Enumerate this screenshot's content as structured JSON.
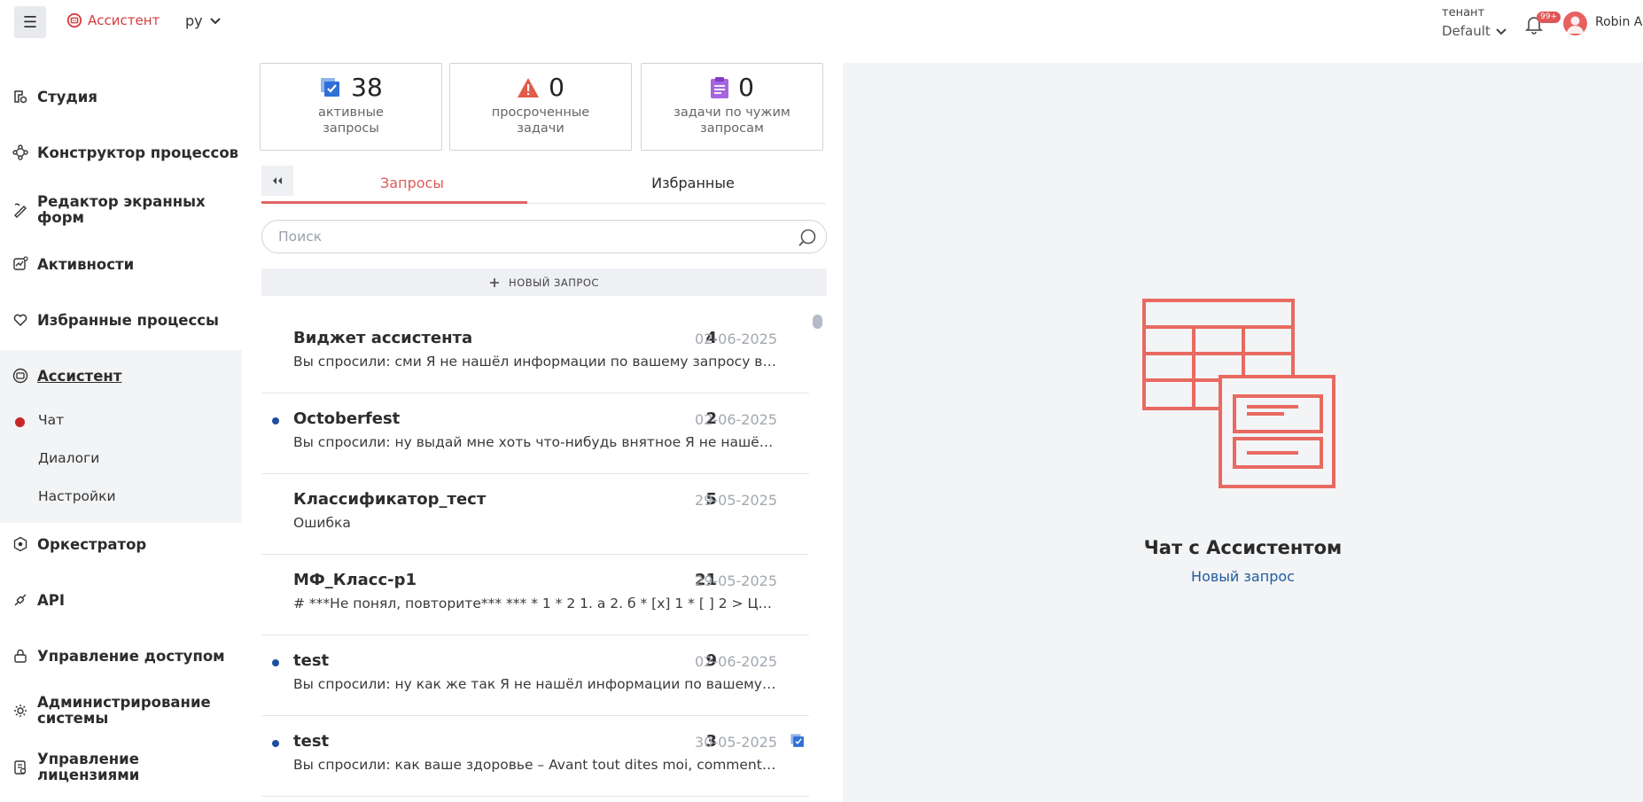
{
  "header": {
    "brand": "Ассистент",
    "language": "ру",
    "tenant_label": "тенант",
    "tenant_value": "Default",
    "notifications_badge": "99+",
    "user_name": "Robin A."
  },
  "sidebar": {
    "items": [
      {
        "label": "Студия",
        "icon": "studio-icon"
      },
      {
        "label": "Конструктор процессов",
        "icon": "process-icon"
      },
      {
        "label": "Редактор экранных форм",
        "icon": "form-editor-icon"
      },
      {
        "label": "Активности",
        "icon": "activities-icon"
      },
      {
        "label": "Избранные процессы",
        "icon": "heart-icon"
      },
      {
        "label": "Ассистент",
        "icon": "assistant-icon"
      },
      {
        "label": "Оркестратор",
        "icon": "orchestrator-icon"
      },
      {
        "label": "API",
        "icon": "api-icon"
      },
      {
        "label": "Управление доступом",
        "icon": "lock-icon"
      },
      {
        "label": "Администрирование системы",
        "icon": "admin-icon"
      },
      {
        "label": "Управление лицензиями",
        "icon": "license-icon"
      }
    ],
    "sub_items": [
      "Чат",
      "Диалоги",
      "Настройки"
    ]
  },
  "stats": [
    {
      "value": "38",
      "label": "активные запросы"
    },
    {
      "value": "0",
      "label": "просроченные задачи"
    },
    {
      "value": "0",
      "label": "задачи по чужим запросам"
    }
  ],
  "tabs": [
    "Запросы",
    "Избранные"
  ],
  "search": {
    "placeholder": "Поиск"
  },
  "new_request_label": "НОВЫЙ ЗАПРОС",
  "requests": [
    {
      "title": "Виджет ассистента",
      "count": "4",
      "date": "02-06-2025",
      "preview": "Вы спросили: сми Я не нашёл информации по вашему запросу в предоставленных документах",
      "unread": false,
      "flag": false
    },
    {
      "title": "Octoberfest",
      "count": "2",
      "date": "02-06-2025",
      "preview": "Вы спросили: ну выдай мне хоть что-нибудь внятное Я не нашёл информации по вашему запросу",
      "unread": true,
      "flag": false
    },
    {
      "title": "Классификатор_тест",
      "count": "5",
      "date": "29-05-2025",
      "preview": "Ошибка",
      "unread": false,
      "flag": false
    },
    {
      "title": "МФ_Класс-р1",
      "count": "21",
      "date": "29-05-2025",
      "preview": "# ***Не понял, повторите*** *** * 1 * 2 1. а 2. б * [x] 1 * [ ] 2 > Цитата > ...",
      "unread": false,
      "flag": false
    },
    {
      "title": "test",
      "count": "9",
      "date": "02-06-2025",
      "preview": "Вы спросили: ну как же так Я не нашёл информации по вашему запросу в предоставленных документах",
      "unread": true,
      "flag": false
    },
    {
      "title": "test",
      "count": "3",
      "date": "30-05-2025",
      "preview": "Вы спросили: как ваше здоровье – Avant tout dites moi, comment vous allez",
      "unread": true,
      "flag": true
    }
  ],
  "panel": {
    "title": "Чат с Ассистентом",
    "link": "Новый запрос"
  },
  "colors": {
    "accent": "#e06565",
    "link": "#1f5a9e",
    "unread_dot": "#1f4fa0",
    "active_dot": "#c62828"
  }
}
